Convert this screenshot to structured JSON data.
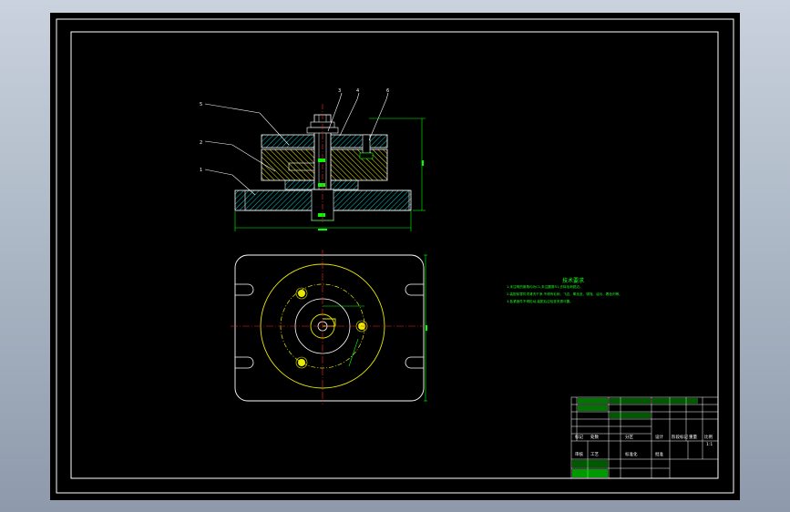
{
  "technical_requirements": {
    "title": "技术要求",
    "lines": [
      "1.未注明的倒角均为C1,未注圆角R1,去除毛刺锐边。",
      "2.装配前零件须清洗干净,不得有毛刺、飞边、氧化皮、锈蚀、油污、着色剂等。",
      "3.各紧固件不得松动,装配后应检查夹紧可靠。"
    ]
  },
  "part_balloons": [
    "1",
    "2",
    "3",
    "4",
    "5",
    "6"
  ],
  "title_block": {
    "labels": [
      "标记",
      "处数",
      "分区",
      "设计",
      "审核",
      "工艺",
      "标准化",
      "批准",
      "阶段标记",
      "重量",
      "比例"
    ],
    "scale": "1:1"
  },
  "colors": {
    "background": "#000000",
    "outline": "#ffffff",
    "centerline": "#ff2020",
    "dimension": "#00ff00",
    "hatch": "#00c8c8",
    "hatch_alt": "#e8e800",
    "balloon_leader": "#ffffff"
  }
}
